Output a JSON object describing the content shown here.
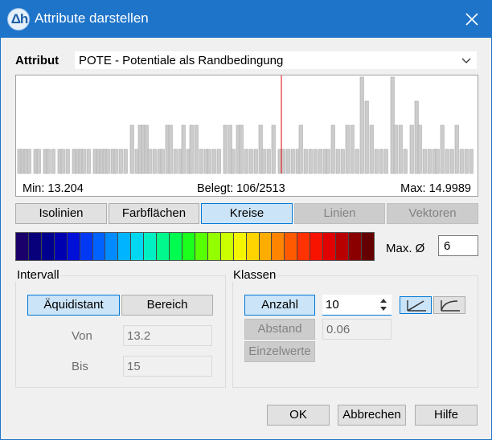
{
  "window": {
    "title": "Attribute darstellen",
    "icon_text": "Δh"
  },
  "attribute": {
    "label": "Attribut",
    "selected": "POTE - Potentiale als Randbedingung"
  },
  "histogram": {
    "min_text": "Min: 13.204",
    "belegt_text": "Belegt: 106/2513",
    "max_text": "Max: 14.9989"
  },
  "tabs": [
    {
      "label": "Isolinien",
      "state": "normal"
    },
    {
      "label": "Farbflächen",
      "state": "normal"
    },
    {
      "label": "Kreise",
      "state": "active"
    },
    {
      "label": "Linien",
      "state": "disabled"
    },
    {
      "label": "Vektoren",
      "state": "disabled"
    }
  ],
  "colors": [
    "#1a006b",
    "#08007a",
    "#00008f",
    "#0000b0",
    "#0010d8",
    "#0038f4",
    "#0062ff",
    "#008cff",
    "#00b4ff",
    "#00d8f2",
    "#00f0c4",
    "#00f88c",
    "#00fc50",
    "#1cff1c",
    "#58ff00",
    "#94ff00",
    "#ccff00",
    "#f2f400",
    "#ffd400",
    "#ffac00",
    "#ff8400",
    "#ff5a00",
    "#ff3200",
    "#f81200",
    "#e00000",
    "#b80000",
    "#8a0000",
    "#650000"
  ],
  "max_diameter": {
    "label": "Max. Ø",
    "value": "6"
  },
  "intervall": {
    "title": "Intervall",
    "aequidistant_label": "Äquidistant",
    "bereich_label": "Bereich",
    "von_label": "Von",
    "von_value": "13.2",
    "bis_label": "Bis",
    "bis_value": "15"
  },
  "klassen": {
    "title": "Klassen",
    "anzahl_label": "Anzahl",
    "anzahl_value": "10",
    "abstand_label": "Abstand",
    "abstand_value": "0.06",
    "einzelwerte_label": "Einzelwerte"
  },
  "footer": {
    "ok_label": "OK",
    "abbrechen_label": "Abbrechen",
    "hilfe_label": "Hilfe"
  }
}
